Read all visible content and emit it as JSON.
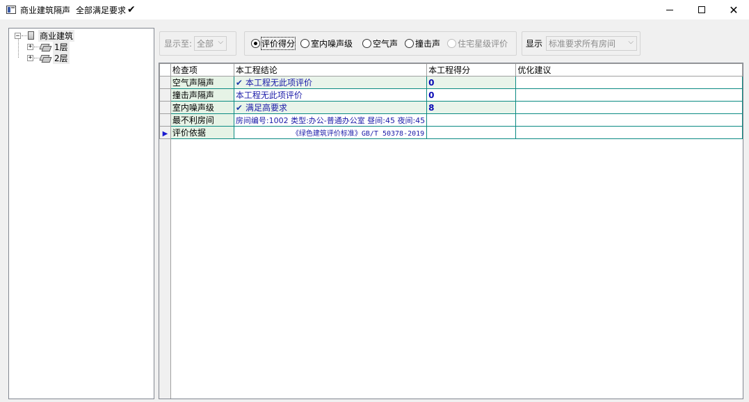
{
  "window": {
    "title": "商业建筑隔声",
    "status": "全部满足要求",
    "status_check": "✔"
  },
  "tree": {
    "root": {
      "label": "商业建筑",
      "expander": "⊟"
    },
    "children": [
      {
        "label": "1层",
        "expander": "+"
      },
      {
        "label": "2层",
        "expander": "+"
      }
    ]
  },
  "toolbar": {
    "display_to_label": "显示至:",
    "display_to_value": "全部",
    "radios": [
      {
        "label": "评价得分",
        "checked": true,
        "enabled": true
      },
      {
        "label": "室内噪声级",
        "checked": false,
        "enabled": true
      },
      {
        "label": "空气声",
        "checked": false,
        "enabled": true
      },
      {
        "label": "撞击声",
        "checked": false,
        "enabled": true
      },
      {
        "label": "住宅星级评价",
        "checked": false,
        "enabled": false
      }
    ],
    "show_label": "显示",
    "show_value": "标准要求所有房间"
  },
  "grid": {
    "columns": [
      "检查项",
      "本工程结论",
      "本工程得分",
      "优化建议"
    ],
    "rows": [
      {
        "item": "空气声隔声",
        "check": "✔",
        "conclusion": "本工程无此项评价",
        "score": "0",
        "advice": ""
      },
      {
        "item": "撞击声隔声",
        "check": "",
        "conclusion": "本工程无此项评价",
        "score": "0",
        "advice": ""
      },
      {
        "item": "室内噪声级",
        "check": "✔",
        "conclusion": "满足高要求",
        "score": "8",
        "advice": ""
      },
      {
        "item": "最不利房间",
        "check": "",
        "conclusion": "房间编号:1002 类型:办公-普通办公室 昼间:45 夜间:45",
        "score": "",
        "advice": ""
      },
      {
        "item": "评价依据",
        "check": "",
        "conclusion": "《绿色建筑评价标准》GB/T 50378-2019",
        "score": "",
        "advice": "",
        "current": true
      }
    ],
    "current_row_marker": "▶"
  }
}
